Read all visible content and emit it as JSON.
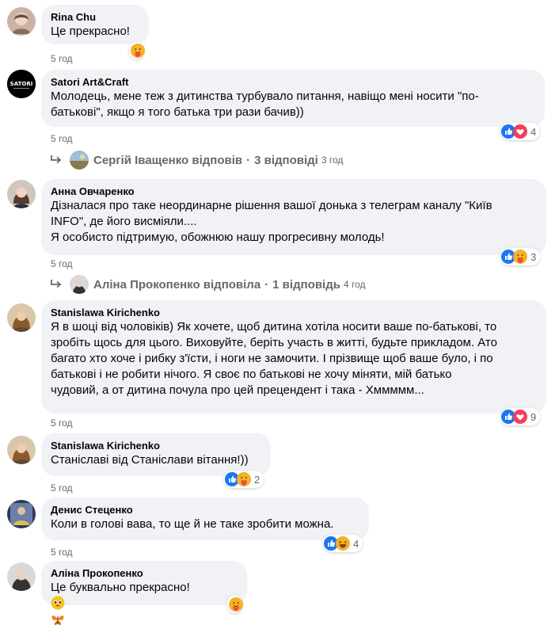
{
  "time_label": "5 год",
  "comments": [
    {
      "name": "Rina Chu",
      "text": "Це прекрасно!"
    },
    {
      "name": "Satori Art&Craft",
      "text": "Молодець, мене теж з дитинства турбувало питання, навіщо мені носити \"по-\nбатькові\", якщо я того батька три рази бачив))",
      "reactions": "4",
      "avatar_logo": "SATORI"
    },
    {
      "name": "Анна Овчаренко",
      "text": "Дізналася про таке неординарне рішення вашої донька з телеграм каналу \"Київ\nINFO\", де його висміяли....\nЯ особисто підтримую, обожнюю нашу прогресивну молодь!",
      "reactions": "3"
    },
    {
      "name": "Stanislawa Kirichenko",
      "text": "Я в шоці від чоловіків) Як хочете, щоб дитина хотіла носити ваше по-батькові, то\nзробіть щось для цього. Виховуйте, беріть участь в житті, будьте прикладом. Ато\nбагато хто хоче і рибку з'їсти, і ноги не замочити. І прізвище щоб ваше було, і по\nбатькові і не робити нічого. Я своє по батькові не хочу міняти, мій батько\nчудовий, а от дитина почула про цей прецендент і така - Хммммм...",
      "reactions": "9"
    },
    {
      "name": "Stanislawa Kirichenko",
      "text": "Станіславі від Станіслави вітання!))",
      "reactions": "2"
    },
    {
      "name": "Денис Стеценко",
      "text": "Коли в голові вава, то ще й не таке зробити можна.",
      "reactions": "4"
    },
    {
      "name": "Аліна Прокопенко",
      "text": "Це буквально прекрасно!"
    }
  ],
  "replies": [
    {
      "who": "Сергій Іващенко відповів",
      "sep": "·",
      "count": "3 відповіді",
      "time": "3 год"
    },
    {
      "who": "Аліна Прокопенко відповіла",
      "sep": "·",
      "count": "1 відповідь",
      "time": "4 год"
    }
  ],
  "colors": {
    "bubble": "#f0f2f5",
    "muted": "#65676b",
    "like": "#1877f2",
    "love": "#f33e58",
    "care": "#f7b125"
  }
}
